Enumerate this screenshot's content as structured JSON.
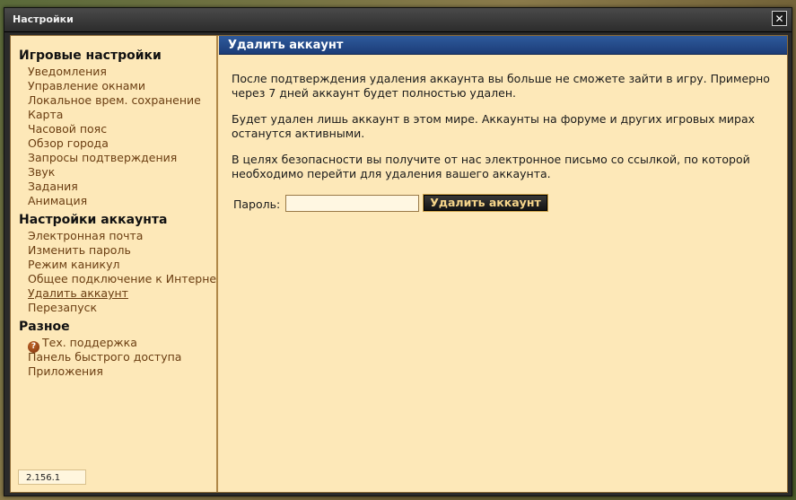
{
  "window": {
    "title": "Настройки",
    "close_symbol": "✕"
  },
  "sidebar": {
    "sections": [
      {
        "heading": "Игровые настройки",
        "items": [
          "Уведомления",
          "Управление окнами",
          "Локальное врем. сохранение",
          "Карта",
          "Часовой пояс",
          "Обзор города",
          "Запросы подтверждения",
          "Звук",
          "Задания",
          "Анимация"
        ]
      },
      {
        "heading": "Настройки аккаунта",
        "items": [
          "Электронная почта",
          "Изменить пароль",
          "Режим каникул",
          "Общее подключение к Интернету",
          "Удалить аккаунт",
          "Перезапуск"
        ]
      },
      {
        "heading": "Разное",
        "items": [
          "Тех. поддержка",
          "Панель быстрого доступа",
          "Приложения"
        ]
      }
    ],
    "active_item": "Удалить аккаунт",
    "help_icon_symbol": "?",
    "version": "2.156.1"
  },
  "main": {
    "header": "Удалить аккаунт",
    "paragraphs": [
      "После подтверждения удаления аккаунта вы больше не сможете зайти в игру. Примерно через 7 дней аккаунт будет полностью удален.",
      "Будет удален лишь аккаунт в этом мире. Аккаунты на форуме и других игровых мирах останутся активными.",
      "В целях безопасности вы получите от нас электронное письмо со ссылкой, по которой необходимо перейти для удаления вашего аккаунта."
    ],
    "password_label": "Пароль:",
    "password_value": "",
    "delete_button_label": "Удалить аккаунт"
  },
  "colors": {
    "panel_header": "#1c3d78",
    "content_bg": "#fde8b8",
    "nav_link": "#6b3e12",
    "button_text": "#f6d58a"
  }
}
